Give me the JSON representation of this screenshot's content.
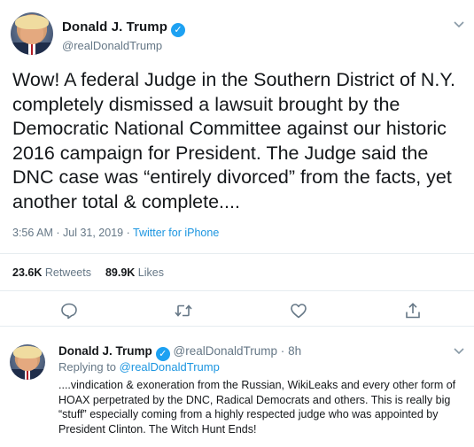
{
  "main_tweet": {
    "display_name": "Donald J. Trump",
    "handle": "@realDonaldTrump",
    "text": "Wow! A federal Judge in the Southern District of N.Y. completely dismissed a lawsuit brought by the Democratic National Committee against our historic 2016 campaign for President. The Judge said the DNC case was “entirely divorced” from the facts, yet another total & complete....",
    "time": "3:56 AM",
    "date": "Jul 31, 2019",
    "source": "Twitter for iPhone",
    "retweets_count": "23.6K",
    "retweets_label": "Retweets",
    "likes_count": "89.9K",
    "likes_label": "Likes"
  },
  "reply_tweet": {
    "display_name": "Donald J. Trump",
    "handle": "@realDonaldTrump",
    "age": "8h",
    "replying_to_label": "Replying to",
    "replying_to_handle": "@realDonaldTrump",
    "text": "....vindication & exoneration from the Russian, WikiLeaks and every other form of HOAX perpetrated by the DNC, Radical Democrats and others. This is really big “stuff” especially coming from a highly respected judge who was appointed by President Clinton. The Witch Hunt Ends!"
  },
  "icons": {
    "verified": "verified-badge-icon",
    "menu": "chevron-down-icon",
    "reply": "reply-icon",
    "retweet": "retweet-icon",
    "like": "heart-icon",
    "share": "share-icon"
  },
  "colors": {
    "link": "#1b95e0",
    "verified": "#1da1f2",
    "muted": "#657786",
    "text": "#14171a",
    "divider": "#e6ecf0"
  }
}
